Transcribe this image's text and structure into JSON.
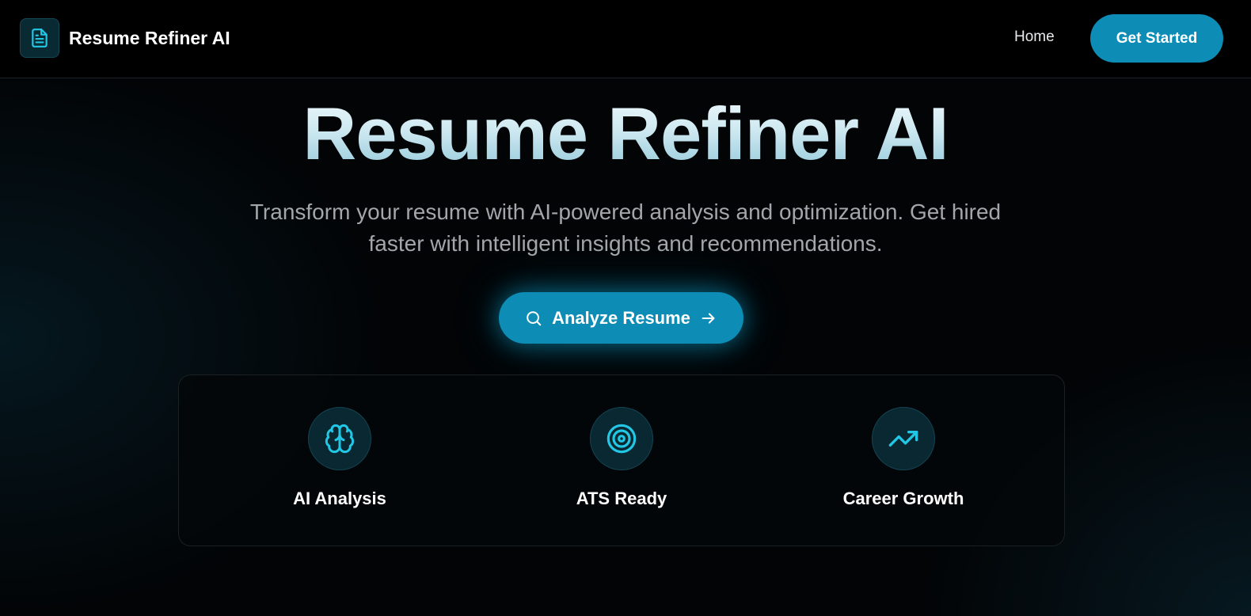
{
  "header": {
    "brand_name": "Resume Refiner AI",
    "brand_icon": "file-text-icon",
    "nav_home": "Home",
    "cta_label": "Get Started"
  },
  "hero": {
    "title": "Resume Refiner AI",
    "subtitle": "Transform your resume with AI-powered analysis and optimization. Get hired faster with intelligent insights and recommendations.",
    "button_label": "Analyze Resume",
    "button_icons": [
      "search-icon",
      "arrow-right-icon"
    ]
  },
  "features": [
    {
      "label": "AI Analysis",
      "icon": "brain-icon"
    },
    {
      "label": "ATS Ready",
      "icon": "target-icon"
    },
    {
      "label": "Career Growth",
      "icon": "trending-up-icon"
    }
  ],
  "colors": {
    "accent": "#0d8db5",
    "icon_accent": "#22c7e6",
    "background": "#020406",
    "subtitle_text": "#a3a6aa"
  }
}
